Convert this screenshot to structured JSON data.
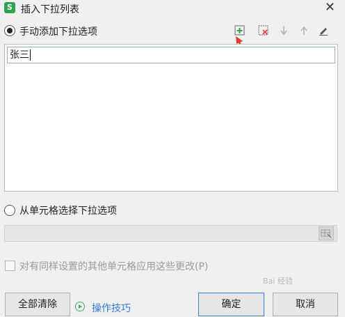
{
  "window": {
    "app_icon_letter": "S",
    "title": "插入下拉列表",
    "close_symbol": "✕"
  },
  "manual_option": {
    "label": "手动添加下拉选项",
    "selected": true
  },
  "toolbar": {
    "icons": [
      "add-item-icon",
      "delete-item-icon",
      "move-down-icon",
      "move-up-icon",
      "edit-icon"
    ],
    "accent_colors": {
      "add": "#2ea44f",
      "delete": "#e0393e",
      "arrow": "#e33b2e"
    }
  },
  "list": {
    "items": [
      "张三"
    ]
  },
  "cell_option": {
    "label": "从单元格选择下拉选项",
    "selected": false
  },
  "range": {
    "value": ""
  },
  "apply_checkbox": {
    "label": "对有同样设置的其他单元格应用这些更改(P)",
    "checked": false
  },
  "footer": {
    "clear_all": "全部清除",
    "tips": "操作技巧",
    "ok": "确定",
    "cancel": "取消"
  }
}
